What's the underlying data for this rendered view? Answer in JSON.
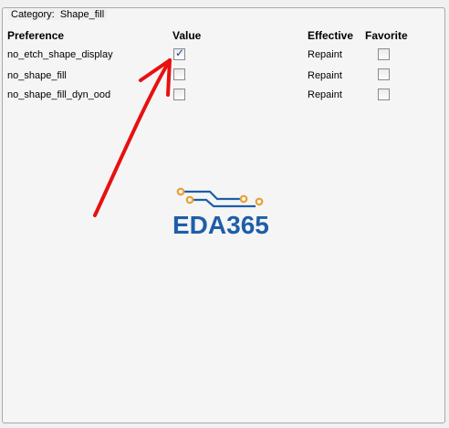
{
  "category": {
    "prefix": "Category:",
    "name": "Shape_fill"
  },
  "columns": {
    "preference": "Preference",
    "value": "Value",
    "effective": "Effective",
    "favorite": "Favorite"
  },
  "rows": [
    {
      "preference": "no_etch_shape_display",
      "value_checked": true,
      "effective": "Repaint",
      "favorite_checked": false
    },
    {
      "preference": "no_shape_fill",
      "value_checked": false,
      "effective": "Repaint",
      "favorite_checked": false
    },
    {
      "preference": "no_shape_fill_dyn_ood",
      "value_checked": false,
      "effective": "Repaint",
      "favorite_checked": false
    }
  ],
  "watermark": {
    "text": "EDA365",
    "text_color": "#1e5ea8",
    "circuit_color": "#e8a33a"
  },
  "annotation": {
    "arrow_color": "#e81010"
  }
}
